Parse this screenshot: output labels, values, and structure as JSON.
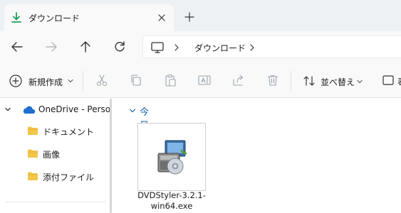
{
  "tab": {
    "title": "ダウンロード",
    "icon": "download-icon",
    "accent": "#1e9e5a"
  },
  "address": {
    "crumb": "ダウンロード"
  },
  "commands": {
    "new_label": "新規作成",
    "sort_label": "並べ替え"
  },
  "nav": {
    "items": [
      {
        "label": "OneDrive - Persona",
        "icon": "onedrive-icon"
      },
      {
        "label": "ドキュメント",
        "icon": "folder-icon"
      },
      {
        "label": "画像",
        "icon": "folder-icon"
      },
      {
        "label": "添付ファイル",
        "icon": "folder-icon"
      }
    ]
  },
  "content": {
    "group_label": "今日",
    "files": [
      {
        "name_line1": "DVDStyler-3.2.1-",
        "name_line2": "win64.exe",
        "icon": "installer-icon"
      }
    ]
  },
  "colors": {
    "folder": "#f3c54a",
    "onedrive": "#1f6fd1",
    "link": "#1a5fb4"
  }
}
